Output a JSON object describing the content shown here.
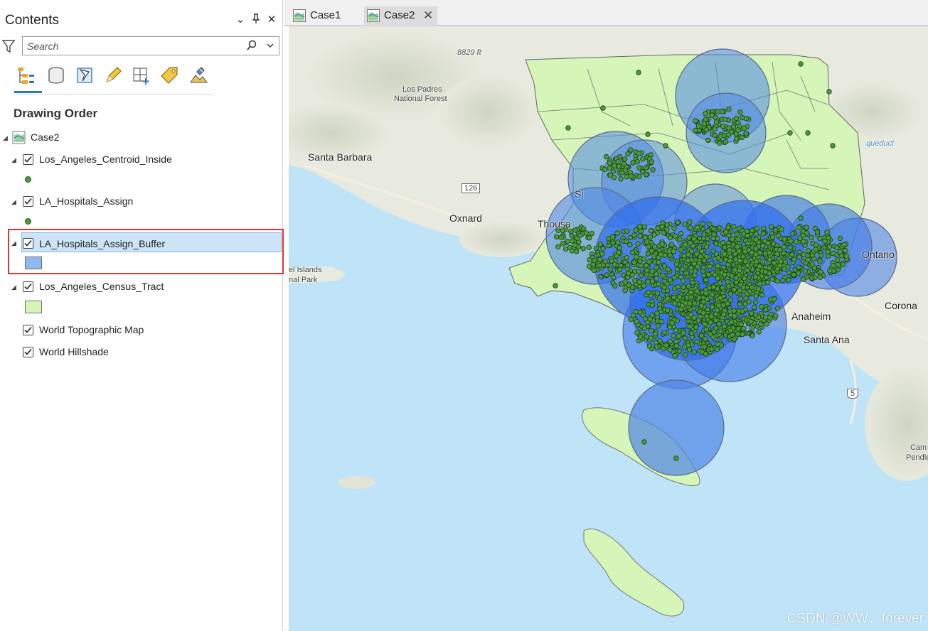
{
  "contents": {
    "title": "Contents",
    "controls": {
      "dropdown": "⌄",
      "pin": "⊥",
      "close": "✕"
    },
    "search": {
      "placeholder": "Search",
      "value": ""
    },
    "toolbar": [
      "list-by-drawing-order-icon",
      "list-by-data-source-icon",
      "list-by-selection-icon",
      "list-by-editing-icon",
      "list-by-snapping-icon",
      "list-by-labeling-icon",
      "list-by-perspective-icon"
    ],
    "section": "Drawing Order",
    "map_name": "Case2",
    "layers": [
      {
        "name": "Los_Angeles_Centroid_Inside",
        "checked": true,
        "symbol": "point",
        "color": "#4a9a3a"
      },
      {
        "name": "LA_Hospitals_Assign",
        "checked": true,
        "symbol": "point",
        "color": "#4a9a3a"
      },
      {
        "name": "LA_Hospitals_Assign_Buffer",
        "checked": true,
        "symbol": "polygon",
        "color": "#92b8f0",
        "selected": true
      },
      {
        "name": "Los_Angeles_Census_Tract",
        "checked": true,
        "symbol": "polygon",
        "color": "#d6f5b8"
      },
      {
        "name": "World Topographic Map",
        "checked": true
      },
      {
        "name": "World Hillshade",
        "checked": true
      }
    ]
  },
  "tabs": [
    {
      "label": "Case1",
      "active": false
    },
    {
      "label": "Case2",
      "active": true,
      "close": "✕"
    }
  ],
  "map": {
    "labels": {
      "elevation": "8829 ft",
      "los_padres": "Los Padres",
      "national_forest": "National Forest",
      "santa_barbara": "Santa Barbara",
      "route_126": "126",
      "oxnard": "Oxnard",
      "thousand_oaks": "Thousa",
      "simi": "Si",
      "islands": "el Islands",
      "nal_park": "nal Park",
      "ontario": "Ontario",
      "corona": "Corona",
      "anaheim": "Anaheim",
      "santa_ana": "Santa Ana",
      "route_5": "5",
      "aqueduct": "queduct",
      "camp": "Cam",
      "pendle": "Pendle"
    },
    "colors": {
      "ocean": "#bfe3f7",
      "land": "#ecece4",
      "tract": "#d6f5b8",
      "buffer": "#3b7cf0",
      "points": "#4a9a3a"
    },
    "watermark": "CSDN @WW、forever"
  }
}
